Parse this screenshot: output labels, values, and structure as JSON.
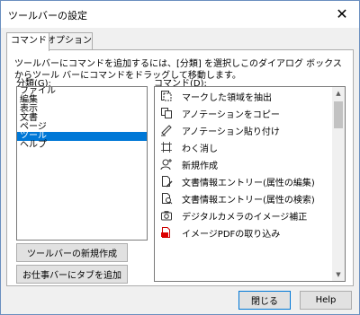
{
  "window": {
    "title": "ツールバーの設定"
  },
  "tabs": [
    {
      "label": "コマンド"
    },
    {
      "label": "オプション"
    }
  ],
  "description": "ツールバーにコマンドを追加するには、[分類] を選択しこのダイアログ ボックスからツール バーにコマンドをドラッグして移動します。",
  "categories": {
    "label": "分類(G):",
    "items": [
      "ファイル",
      "編集",
      "表示",
      "文書",
      "ページ",
      "ツール",
      "ヘルプ"
    ],
    "selected": "ツール"
  },
  "commands": {
    "label": "コマンド(D):",
    "items": [
      {
        "label": "マークした領域を抽出",
        "icon": "extract-icon"
      },
      {
        "label": "アノテーションをコピー",
        "icon": "copy-annotation-icon"
      },
      {
        "label": "アノテーション貼り付け",
        "icon": "paste-annotation-icon"
      },
      {
        "label": "わく消し",
        "icon": "frame-erase-icon"
      },
      {
        "label": "新規作成",
        "icon": "new-user-icon"
      },
      {
        "label": "文書情報エントリー(属性の編集)",
        "icon": "doc-info-edit-icon"
      },
      {
        "label": "文書情報エントリー(属性の検索)",
        "icon": "doc-info-search-icon"
      },
      {
        "label": "デジタルカメラのイメージ補正",
        "icon": "camera-icon"
      },
      {
        "label": "イメージPDFの取り込み",
        "icon": "image-pdf-icon"
      }
    ]
  },
  "buttons": {
    "new_toolbar": "ツールバーの新規作成",
    "add_tab": "お仕事バーにタブを追加",
    "close": "閉じる",
    "help": "Help"
  }
}
